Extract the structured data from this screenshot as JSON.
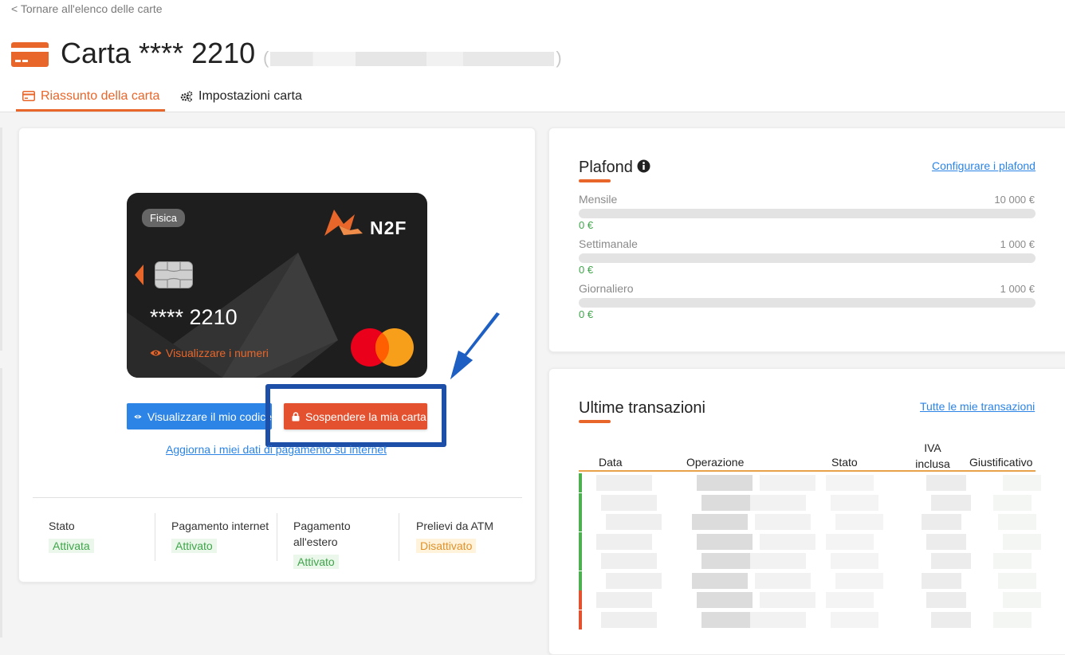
{
  "nav": {
    "back_link": "< Tornare all'elenco delle carte"
  },
  "header": {
    "title": "Carta **** 2210",
    "masked_open": "(",
    "masked_close": ")"
  },
  "tabs": [
    {
      "label": "Riassunto della carta",
      "icon": "card-icon",
      "active": true
    },
    {
      "label": "Impostazioni carta",
      "icon": "gears-icon",
      "active": false
    }
  ],
  "card": {
    "badge": "Fisica",
    "brand": "N2F",
    "masked_number": "**** 2210",
    "view_numbers": "Visualizzare i numeri",
    "network": "mastercard-icon"
  },
  "actions": {
    "view_code": "Visualizzare il mio codice",
    "suspend": "Sospendere la mia carta",
    "update_payment": "Aggiorna i miei dati di pagamento su internet"
  },
  "status": [
    {
      "label": "Stato",
      "value": "Attivata",
      "state": "on"
    },
    {
      "label": "Pagamento internet",
      "value": "Attivato",
      "state": "on"
    },
    {
      "label": "Pagamento all'estero",
      "value": "Attivato",
      "state": "on"
    },
    {
      "label": "Prelievi da ATM",
      "value": "Disattivato",
      "state": "off"
    }
  ],
  "plafond": {
    "title": "Plafond",
    "configure_link": "Configurare i plafond",
    "limits": [
      {
        "label": "Mensile",
        "max": "10 000 €",
        "used": "0 €",
        "used_fraction": 0
      },
      {
        "label": "Settimanale",
        "max": "1 000 €",
        "used": "0 €",
        "used_fraction": 0
      },
      {
        "label": "Giornaliero",
        "max": "1 000 €",
        "used": "0 €",
        "used_fraction": 0
      }
    ]
  },
  "transactions": {
    "title": "Ultime transazioni",
    "all_link": "Tutte le mie transazioni",
    "columns": [
      "Data",
      "Operazione",
      "Stato",
      "IVA inclusa",
      "Giustificativo"
    ],
    "row_status_colors": [
      "#4caf50",
      "#4caf50",
      "#4caf50",
      "#4caf50",
      "#4caf50",
      "#4caf50",
      "#e3512f",
      "#e3512f"
    ]
  },
  "colors": {
    "accent": "#e8662a",
    "primary_button": "#2b84e6",
    "danger_button": "#e3512f",
    "highlight": "#1e4fa8",
    "success": "#3fa54a",
    "warning": "#e0922a"
  }
}
